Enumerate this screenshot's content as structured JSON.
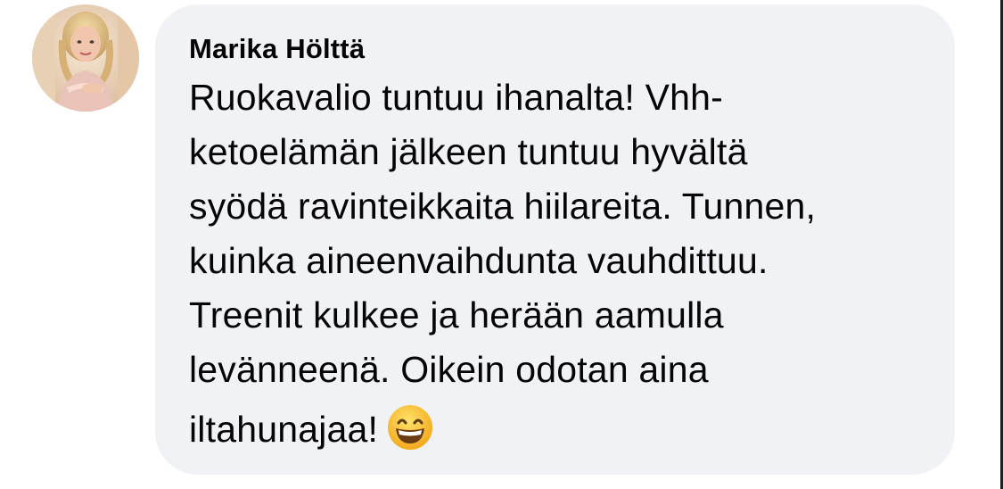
{
  "comment": {
    "author_name": "Marika Hölttä",
    "text_lines": [
      "Ruokavalio tuntuu ihanalta! Vhh-",
      "ketoelämän jälkeen tuntuu hyvältä",
      "syödä ravinteikkaita hiilareita. Tunnen,",
      "kuinka aineenvaihdunta vauhdittuu.",
      "Treenit kulkee ja herään aamulla",
      "levänneenä. Oikein odotan aina"
    ],
    "last_line": "iltahunajaa!",
    "emoji": "grinning-face-with-smiling-eyes-emoji",
    "avatar": "profile-photo-avatar"
  },
  "colors": {
    "bubble_background": "#f0f2f5",
    "text": "#050505"
  }
}
